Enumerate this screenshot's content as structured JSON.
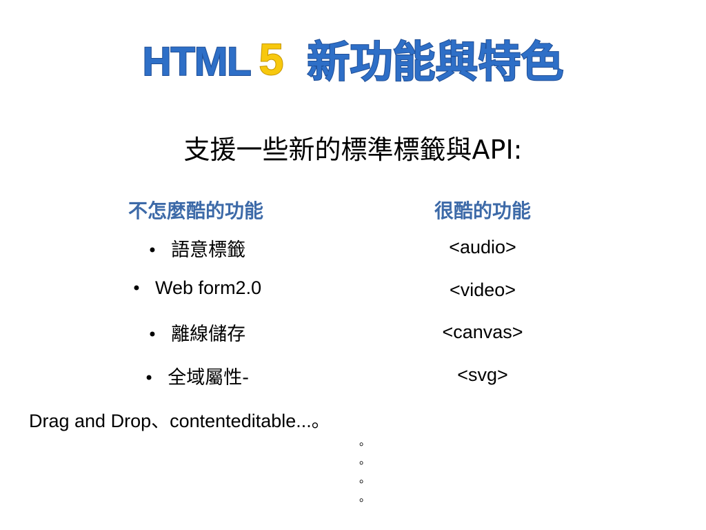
{
  "title": {
    "html": "HTML",
    "five": "5",
    "rest": "新功能與特色"
  },
  "subtitle": "支援一些新的標準標籤與API:",
  "columns": {
    "left_heading": "不怎麼酷的功能",
    "right_heading": "很酷的功能"
  },
  "left_items": [
    "語意標籤",
    "Web form2.0",
    "離線儲存",
    "全域屬性-"
  ],
  "bullet_char": "•",
  "right_items": [
    "<audio>",
    "<video>",
    "<canvas>",
    "<svg>"
  ],
  "drag_line": {
    "text": "Drag and Drop",
    "sep": "、",
    "tail": "contenteditable...",
    "end_mark": "。"
  },
  "trailing_marks": [
    "。",
    "。",
    "。",
    "。"
  ],
  "colors": {
    "title_blue": "#2e6fc7",
    "title_outline": "#1f4e96",
    "five_yellow": "#f7c80e",
    "heading_blue": "#3d6aa8"
  }
}
